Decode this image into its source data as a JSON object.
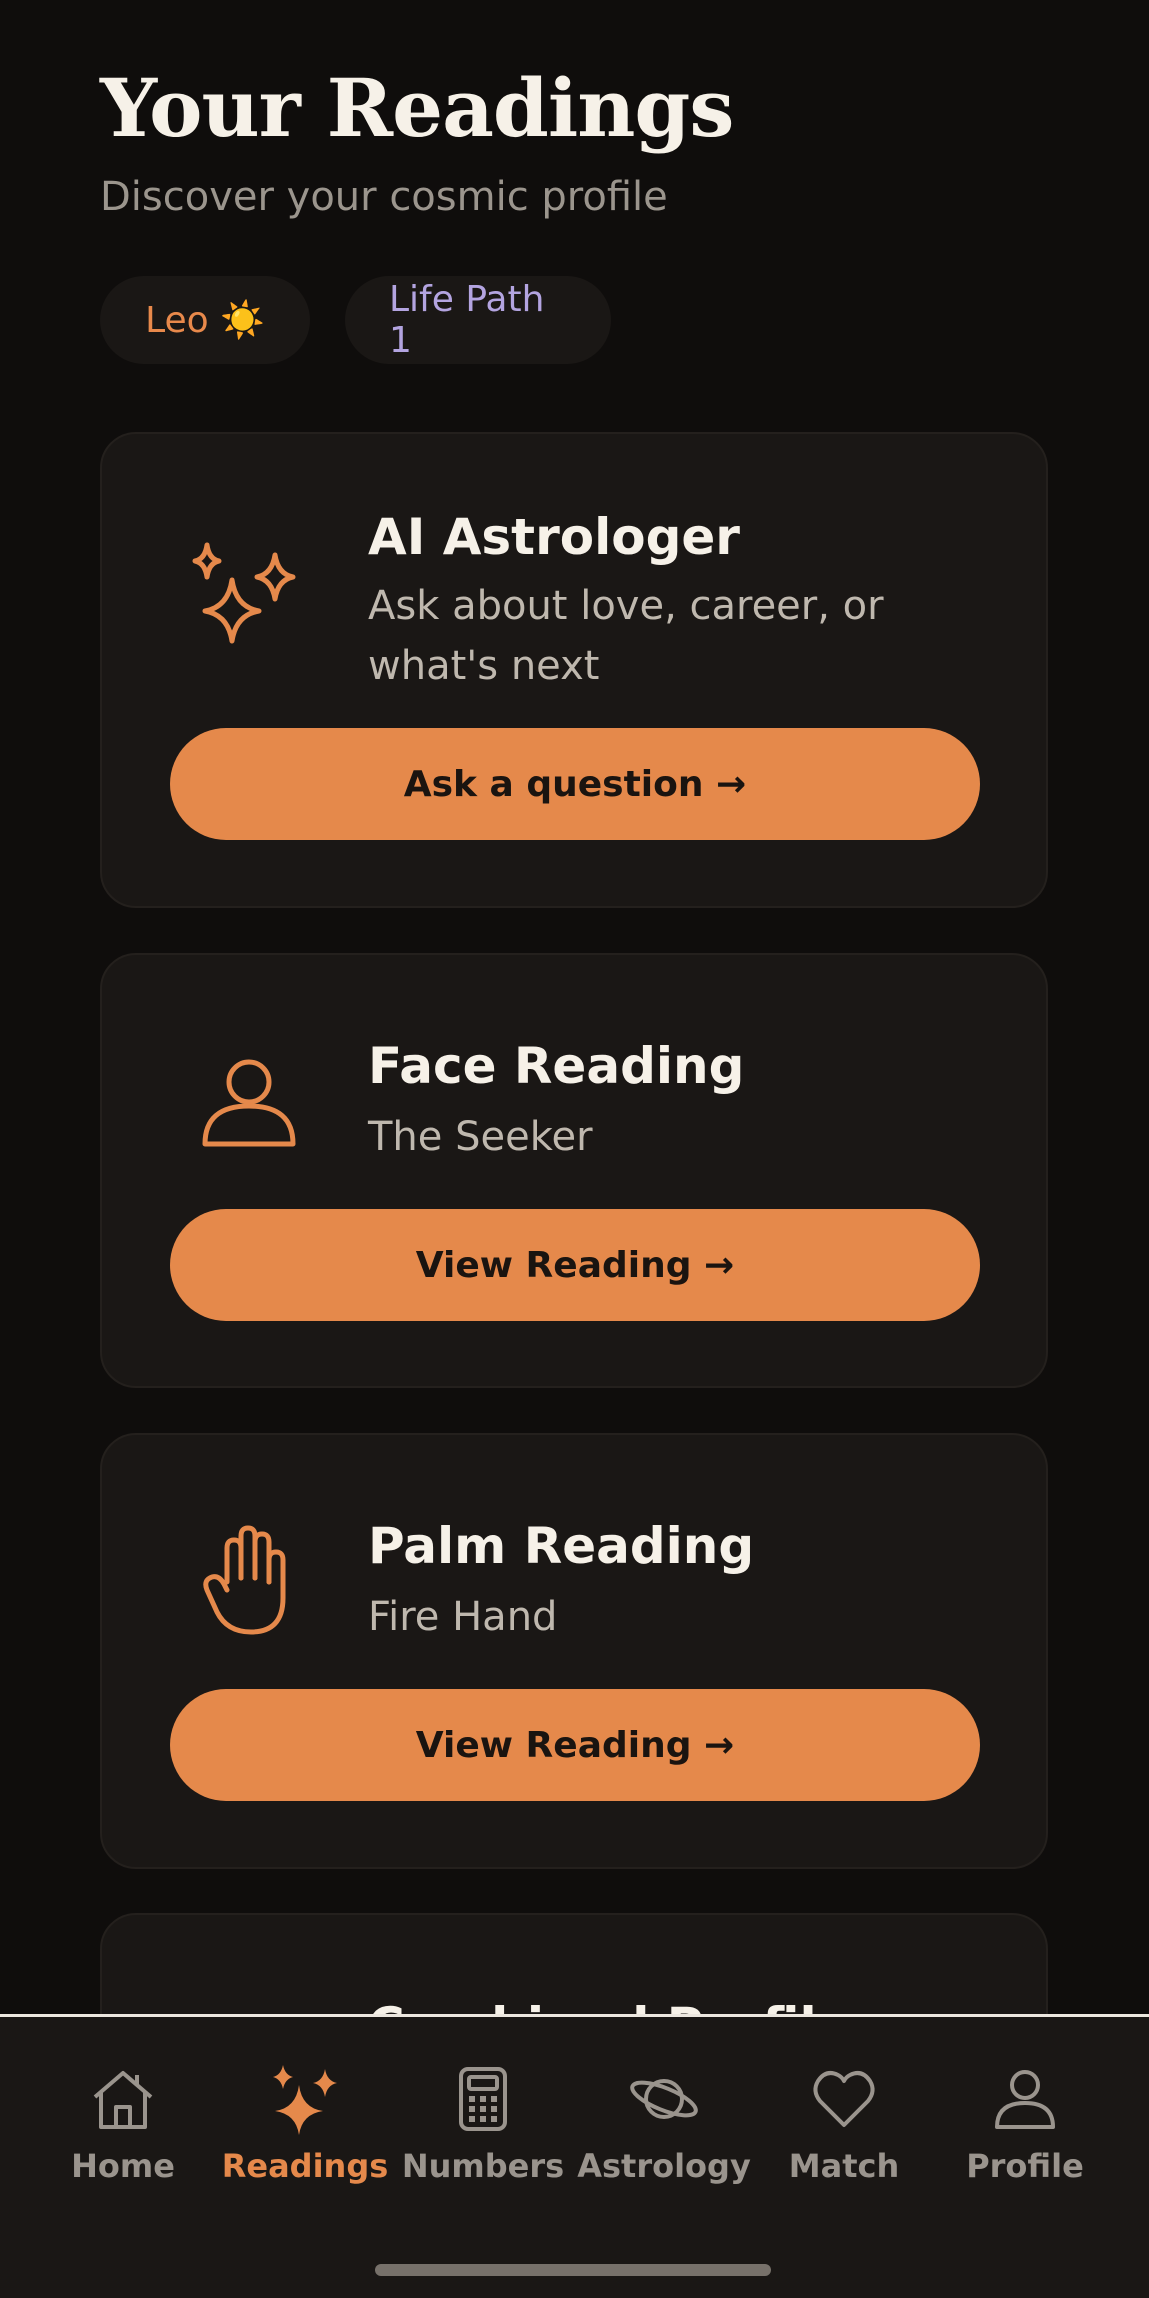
{
  "header": {
    "title": "Your Readings",
    "subtitle": "Discover your cosmic profile"
  },
  "chips": {
    "sign": "Leo ☀️",
    "life_path": "Life Path 1"
  },
  "cards": [
    {
      "title": "AI Astrologer",
      "desc": "Ask about love, career, or what's next",
      "button": "Ask a question →",
      "icon": "sparkles-icon"
    },
    {
      "title": "Face Reading",
      "desc": "The Seeker",
      "button": "View Reading →",
      "icon": "person-icon"
    },
    {
      "title": "Palm Reading",
      "desc": "Fire Hand",
      "button": "View Reading →",
      "icon": "hand-icon"
    },
    {
      "title": "Combined Profile",
      "desc": "",
      "button": "",
      "icon": ""
    }
  ],
  "tabbar": {
    "items": [
      {
        "label": "Home",
        "icon": "home-icon"
      },
      {
        "label": "Readings",
        "icon": "sparkles-icon",
        "active": true
      },
      {
        "label": "Numbers",
        "icon": "calculator-icon"
      },
      {
        "label": "Astrology",
        "icon": "planet-icon"
      },
      {
        "label": "Match",
        "icon": "heart-icon"
      },
      {
        "label": "Profile",
        "icon": "person-icon"
      }
    ]
  },
  "colors": {
    "accent": "#e5894b",
    "background": "#0f0d0c",
    "card": "#1a1715",
    "life_path": "#b3a4e0"
  }
}
